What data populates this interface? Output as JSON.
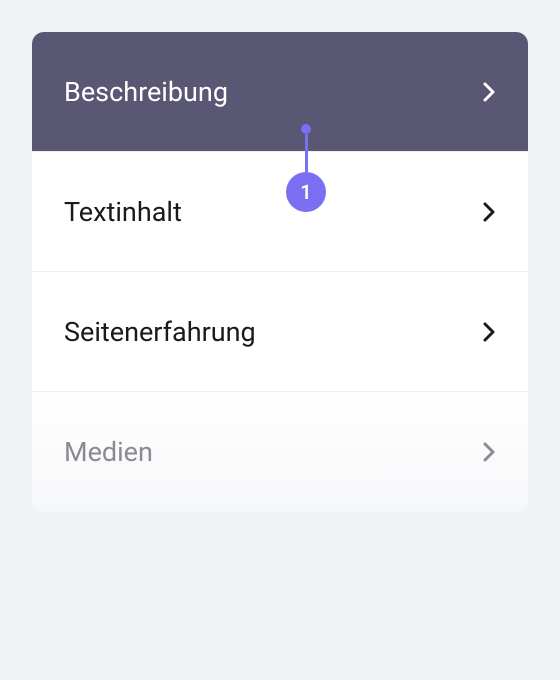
{
  "menu": {
    "items": [
      {
        "label": "Beschreibung",
        "active": true
      },
      {
        "label": "Textinhalt",
        "active": false
      },
      {
        "label": "Seitenerfahrung",
        "active": false
      },
      {
        "label": "Medien",
        "active": false,
        "faded": true
      }
    ]
  },
  "callout": {
    "number": "1"
  }
}
